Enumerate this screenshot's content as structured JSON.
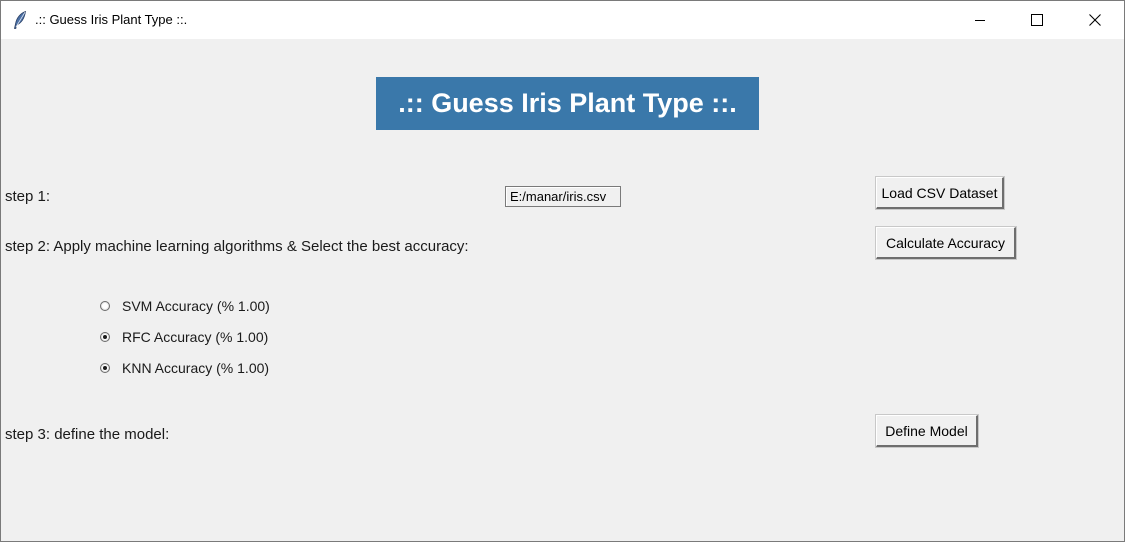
{
  "window": {
    "title": ".:: Guess Iris Plant Type ::.",
    "controls": [
      "minimize-icon",
      "maximize-icon",
      "close-icon"
    ]
  },
  "header": {
    "title": ".:: Guess Iris Plant Type ::.",
    "background": "#3a78aa",
    "text_color": "#ffffff"
  },
  "step1": {
    "label": "step 1:",
    "path_value": "E:/manar/iris.csv",
    "button_label": "Load CSV Dataset"
  },
  "step2": {
    "label": "step 2: Apply machine learning algorithms & Select the best accuracy:",
    "button_label": "Calculate Accuracy",
    "options": [
      {
        "label": "SVM Accuracy (% 1.00)",
        "checked": false
      },
      {
        "label": "RFC Accuracy (% 1.00)",
        "checked": true
      },
      {
        "label": "KNN Accuracy (% 1.00)",
        "checked": true
      }
    ]
  },
  "step3": {
    "label": "step 3: define the model:",
    "button_label": "Define Model"
  }
}
